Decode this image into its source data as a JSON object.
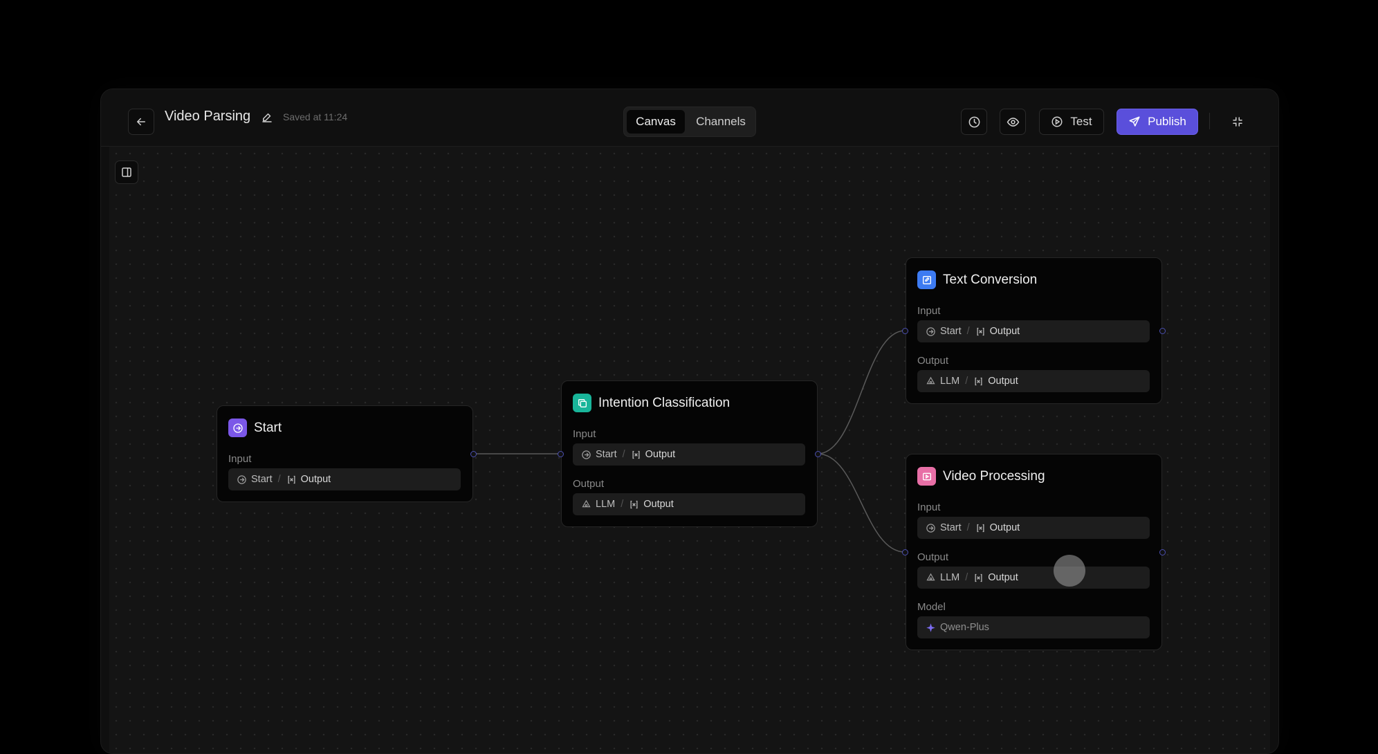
{
  "header": {
    "title": "Video Parsing",
    "saved": "Saved at 11:24",
    "tabs": [
      {
        "label": "Canvas",
        "active": true
      },
      {
        "label": "Channels",
        "active": false
      }
    ],
    "test_label": "Test",
    "publish_label": "Publish"
  },
  "colors": {
    "accent": "#5a4fdb",
    "start_icon": "#7b57e8",
    "intention_icon": "#19b59a",
    "text_icon": "#3d7bf2",
    "video_icon": "#e86fa6"
  },
  "nodes": {
    "start": {
      "title": "Start",
      "input_label": "Input",
      "input": {
        "source": "Start",
        "sep": "/",
        "var": "Output"
      }
    },
    "intention": {
      "title": "Intention Classification",
      "input_label": "Input",
      "input": {
        "source": "Start",
        "sep": "/",
        "var": "Output"
      },
      "output_label": "Output",
      "output": {
        "source": "LLM",
        "sep": "/",
        "var": "Output"
      }
    },
    "text": {
      "title": "Text Conversion",
      "input_label": "Input",
      "input": {
        "source": "Start",
        "sep": "/",
        "var": "Output"
      },
      "output_label": "Output",
      "output": {
        "source": "LLM",
        "sep": "/",
        "var": "Output"
      }
    },
    "video": {
      "title": "Video Processing",
      "input_label": "Input",
      "input": {
        "source": "Start",
        "sep": "/",
        "var": "Output"
      },
      "output_label": "Output",
      "output": {
        "source": "LLM",
        "sep": "/",
        "var": "Output"
      },
      "model_label": "Model",
      "model": "Qwen-Plus"
    }
  }
}
